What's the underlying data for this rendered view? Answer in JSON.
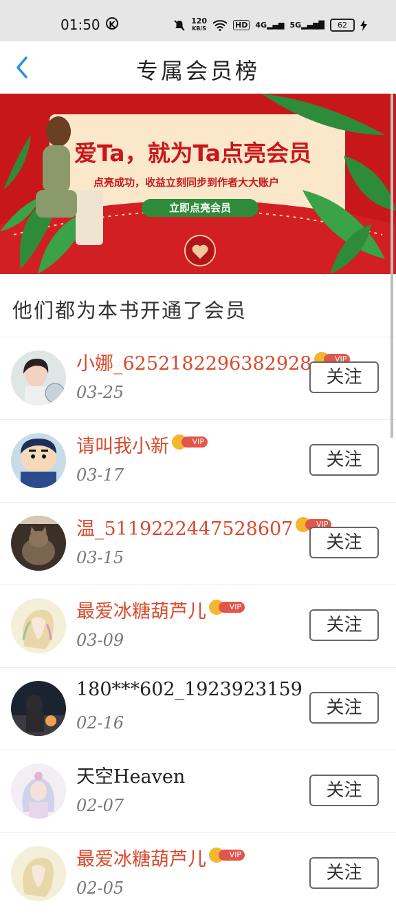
{
  "status_bar": {
    "time": "01:50",
    "k_icon": "K",
    "speed_value": "120",
    "speed_unit": "KB/S",
    "hd_label": "HD",
    "net1": "4G",
    "net2": "5G",
    "battery": "62"
  },
  "header": {
    "title": "专属会员榜"
  },
  "banner": {
    "headline": "爱Ta，就为Ta点亮会员",
    "subline": "点亮成功，收益立刻同步到作者大大账户",
    "cta": "立即点亮会员"
  },
  "section_label": "他们都为本书开通了会员",
  "colors": {
    "vip_name": "#d84a2c",
    "banner_red": "#c8171b",
    "banner_green": "#2e8b3a",
    "back_blue": "#2a8fe0"
  },
  "follow_label": "关注",
  "vip_label": "VIP",
  "members": [
    {
      "name": "小娜_6252182296382928",
      "date": "03-25",
      "vip": true
    },
    {
      "name": "请叫我小新",
      "date": "03-17",
      "vip": true
    },
    {
      "name": "温_5119222447528607",
      "date": "03-15",
      "vip": true
    },
    {
      "name": "最爱冰糖葫芦儿",
      "date": "03-09",
      "vip": true
    },
    {
      "name": "180***602_1923923159",
      "date": "02-16",
      "vip": false
    },
    {
      "name": "天空Heaven",
      "date": "02-07",
      "vip": false
    },
    {
      "name": "最爱冰糖葫芦儿",
      "date": "02-05",
      "vip": true
    }
  ]
}
